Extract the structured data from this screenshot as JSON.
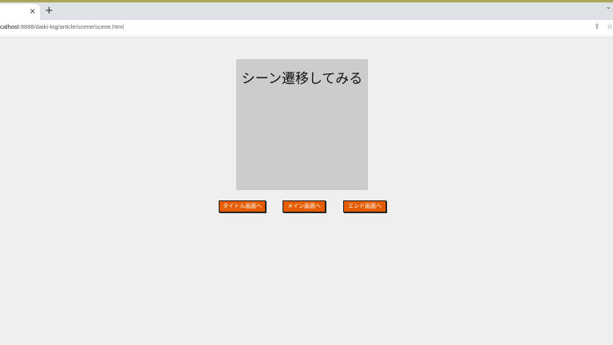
{
  "browser": {
    "tab_close_glyph": "×",
    "new_tab_glyph": "+",
    "chevron_glyph": "⌄",
    "url_host": "calhost",
    "url_rest": ":8888/daiki-log/article/scene/scene.html",
    "share_glyph": "⇪",
    "star_glyph": "☆"
  },
  "scene": {
    "title": "シーン遷移してみる"
  },
  "buttons": {
    "title_screen": "タイトル画面へ",
    "main_screen": "メイン画面へ",
    "end_screen": "エンド画面へ"
  },
  "colors": {
    "page_bg": "#efefef",
    "scene_bg": "#cccccc",
    "button_bg": "#e65c00",
    "button_text": "#ffffff"
  }
}
